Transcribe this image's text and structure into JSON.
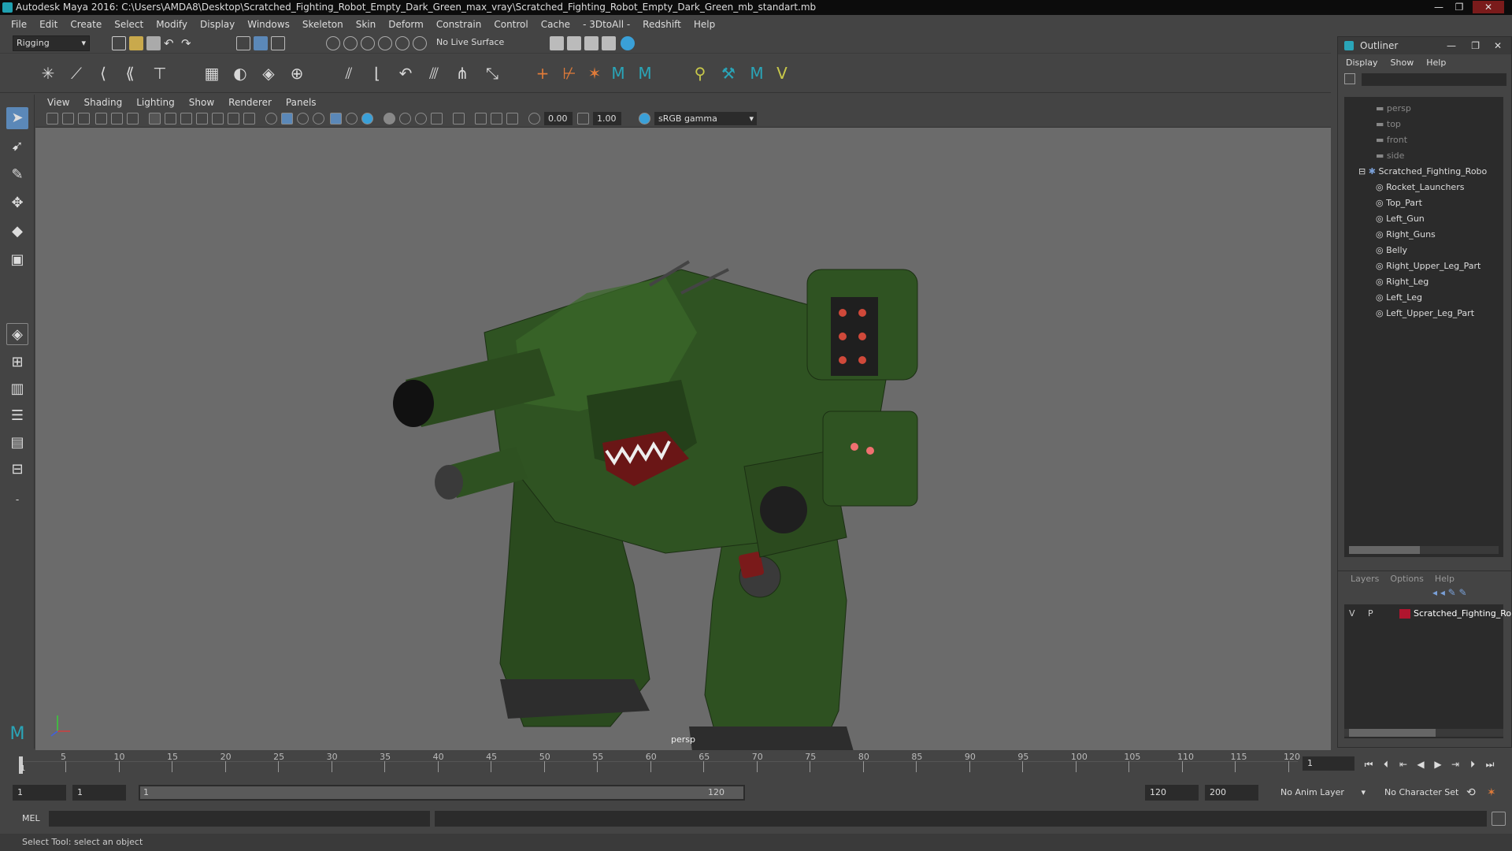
{
  "window": {
    "title": "Autodesk Maya 2016: C:\\Users\\AMDA8\\Desktop\\Scratched_Fighting_Robot_Empty_Dark_Green_max_vray\\Scratched_Fighting_Robot_Empty_Dark_Green_mb_standart.mb"
  },
  "menubar": [
    "File",
    "Edit",
    "Create",
    "Select",
    "Modify",
    "Display",
    "Windows",
    "Skeleton",
    "Skin",
    "Deform",
    "Constrain",
    "Control",
    "Cache",
    "- 3DtoAll -",
    "Redshift",
    "Help"
  ],
  "statusline": {
    "mode": "Rigging",
    "live_surface": "No Live Surface"
  },
  "viewport": {
    "menu": [
      "View",
      "Shading",
      "Lighting",
      "Show",
      "Renderer",
      "Panels"
    ],
    "exposure": "0.00",
    "gamma": "1.00",
    "color_space": "sRGB gamma",
    "camera_label": "persp"
  },
  "outliner": {
    "title": "Outliner",
    "menu": [
      "Display",
      "Show",
      "Help"
    ],
    "cameras": [
      "persp",
      "top",
      "front",
      "side"
    ],
    "root": "Scratched_Fighting_Robo",
    "children": [
      "Rocket_Launchers",
      "Top_Part",
      "Left_Gun",
      "Right_Guns",
      "Belly",
      "Right_Upper_Leg_Part",
      "Right_Leg",
      "Left_Leg",
      "Left_Upper_Leg_Part"
    ]
  },
  "layers": {
    "menu": [
      "Layers",
      "Options",
      "Help"
    ],
    "row": {
      "v": "V",
      "p": "P",
      "name": "Scratched_Fighting_Ro",
      "color": "#b0152e"
    }
  },
  "timeline": {
    "ticks": [
      "5",
      "10",
      "15",
      "20",
      "25",
      "30",
      "35",
      "40",
      "45",
      "50",
      "55",
      "60",
      "65",
      "70",
      "75",
      "80",
      "85",
      "90",
      "95",
      "100",
      "105",
      "110",
      "115",
      "120"
    ],
    "start_marker": "1",
    "current_frame": "1"
  },
  "range": {
    "start": "1",
    "playback_start": "1",
    "slider_start": "1",
    "slider_end": "120",
    "playback_end": "120",
    "end": "200",
    "anim_layer": "No Anim Layer",
    "char_set": "No Character Set"
  },
  "command": {
    "label": "MEL"
  },
  "help_line": "Select Tool: select an object",
  "colors": {
    "robot_green": "#2a4a1e",
    "maya_teal": "#1fa0b0"
  }
}
